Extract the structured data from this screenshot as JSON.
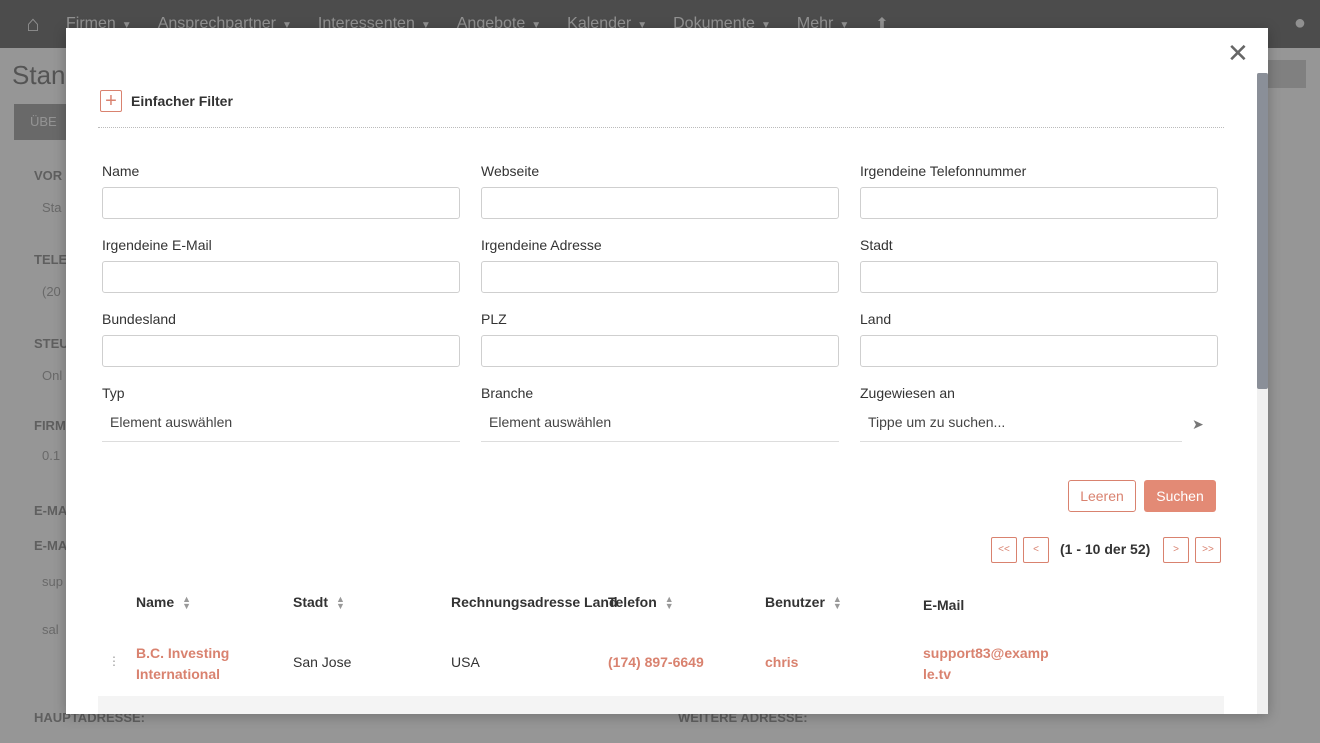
{
  "background": {
    "nav": [
      "Firmen",
      "Ansprechpartner",
      "Interessenten",
      "Angebote",
      "Kalender",
      "Dokumente",
      "Mehr"
    ],
    "page_title": "Stan",
    "button": "ÜBE",
    "labels": [
      "VOR",
      "TELE",
      "STEU",
      "FIRM",
      "E-MA",
      "E-MA"
    ],
    "values": [
      "Sta",
      "(20",
      "Onl",
      "0.1",
      "sup",
      "sal"
    ],
    "bottom_left": "HAUPTADRESSE:",
    "bottom_right": "WEITERE ADRESSE:"
  },
  "modal": {
    "filter_title": "Einfacher Filter",
    "fields": [
      {
        "label": "Name",
        "value": ""
      },
      {
        "label": "Webseite",
        "value": ""
      },
      {
        "label": "Irgendeine Telefonnummer",
        "value": ""
      },
      {
        "label": "Irgendeine E-Mail",
        "value": ""
      },
      {
        "label": "Irgendeine Adresse",
        "value": ""
      },
      {
        "label": "Stadt",
        "value": ""
      },
      {
        "label": "Bundesland",
        "value": ""
      },
      {
        "label": "PLZ",
        "value": ""
      },
      {
        "label": "Land",
        "value": ""
      }
    ],
    "selects": [
      {
        "label": "Typ",
        "value": "Element auswählen"
      },
      {
        "label": "Branche",
        "value": "Element auswählen"
      },
      {
        "label": "Zugewiesen an",
        "value": "Tippe um zu suchen..."
      }
    ],
    "clear_label": "Leeren",
    "search_label": "Suchen",
    "pager": {
      "first": "<<",
      "prev": "<",
      "info": "(1 - 10 der 52)",
      "next": ">",
      "last": ">>"
    },
    "columns": [
      "Name",
      "Stadt",
      "Rechnungsadresse Land",
      "Telefon",
      "Benutzer",
      "E-Mail"
    ],
    "rows": [
      {
        "name_line1": "B.C. Investing",
        "name_line2": "International",
        "city": "San Jose",
        "country": "USA",
        "phone": "(174) 897-6649",
        "user": "chris",
        "email_line1": "support83@examp",
        "email_line2": "le.tv"
      }
    ]
  },
  "colors": {
    "accent": "#e38a75",
    "accent_text": "#d9826f"
  }
}
